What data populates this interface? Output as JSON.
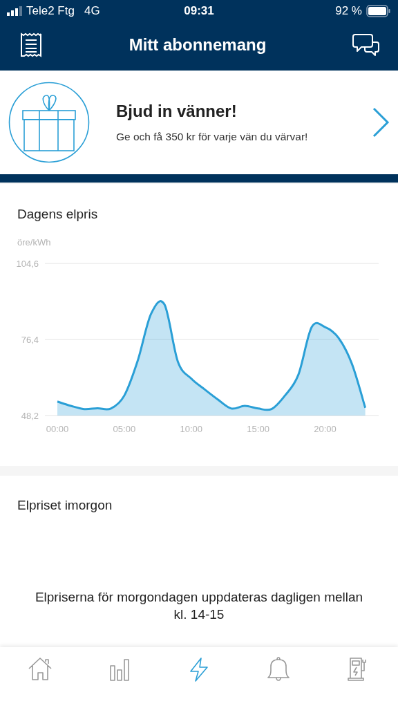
{
  "status_bar": {
    "carrier": "Tele2 Ftg",
    "network": "4G",
    "time": "09:31",
    "battery": "92 %"
  },
  "header": {
    "title": "Mitt abonnemang"
  },
  "promo": {
    "title": "Bjud in vänner!",
    "text": "Ge och få 350 kr för varje vän du värvar!"
  },
  "price_today": {
    "title": "Dagens elpris",
    "unit": "öre/kWh",
    "chart_data": {
      "type": "area",
      "x": [
        0,
        1,
        2,
        3,
        4,
        5,
        6,
        7,
        8,
        9,
        10,
        11,
        12,
        13,
        14,
        15,
        16,
        17,
        18,
        19,
        20,
        21,
        22,
        23
      ],
      "series": [
        {
          "color": "#2a9fd6",
          "values": [
            53.4,
            51.8,
            50.6,
            50.9,
            50.8,
            55.6,
            68.5,
            85.9,
            89.4,
            68.2,
            61.9,
            57.9,
            54.1,
            50.8,
            51.8,
            50.8,
            50.6,
            55.6,
            63.3,
            81.0,
            81.0,
            77.0,
            67.4,
            51.1
          ]
        }
      ],
      "ylim": [
        48.2,
        104.6
      ],
      "xlim": [
        -0.93,
        24
      ],
      "yticks": [
        {
          "value": 48.2,
          "label": "48,2"
        },
        {
          "value": 76.4,
          "label": "76,4"
        },
        {
          "value": 104.6,
          "label": "104,6"
        }
      ],
      "xticks": [
        {
          "value": 0,
          "label": "00:00"
        },
        {
          "value": 5,
          "label": "05:00"
        },
        {
          "value": 10,
          "label": "10:00"
        },
        {
          "value": 15,
          "label": "15:00"
        },
        {
          "value": 20,
          "label": "20:00"
        }
      ]
    }
  },
  "price_tomorrow": {
    "title": "Elpriset imorgon",
    "message": "Elpriserna för morgondagen uppdateras dagligen mellan kl. 14-15"
  },
  "tab_bar": [
    {
      "kind": "home",
      "selected": false
    },
    {
      "kind": "stats",
      "selected": false
    },
    {
      "kind": "power",
      "selected": true
    },
    {
      "kind": "bell",
      "selected": false
    },
    {
      "kind": "charger",
      "selected": false
    }
  ]
}
